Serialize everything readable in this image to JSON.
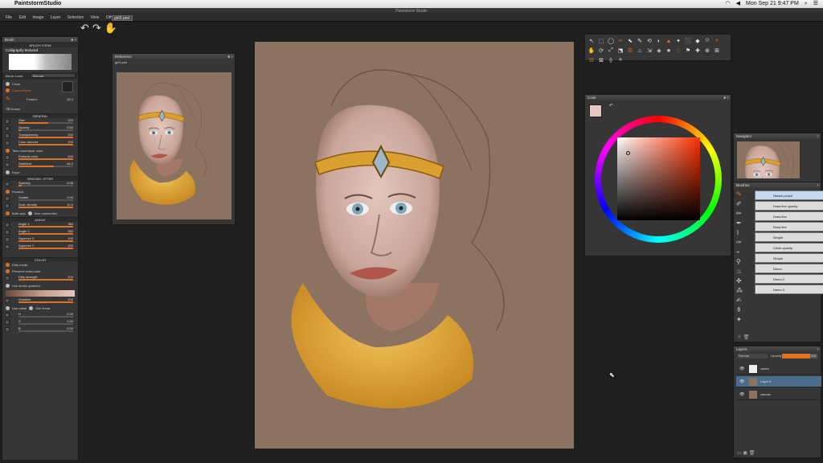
{
  "mac": {
    "app": "PaintstormStudio",
    "clock": "Mon Sep 21  9:47 PM"
  },
  "window": {
    "title": "Paintstorm Studio"
  },
  "menu": [
    "File",
    "Edit",
    "Image",
    "Layer",
    "Selection",
    "View",
    "Other"
  ],
  "doc_tab": "girl3.psd",
  "brush_panel": {
    "title": "Brush",
    "form_header": "BRUSH FORM",
    "form_name": "Calligraphy textured",
    "blend_mode_label": "Blend mode:",
    "blend_mode": "Normal",
    "shape_circle": "Circle",
    "shape_custom": "Custom form",
    "feature_label": "Feature",
    "feature_value": "26.3",
    "eraser": "Eraser",
    "general_header": "GENERAL",
    "general": [
      {
        "label": "Size",
        "value": "220",
        "pct": 55
      },
      {
        "label": "Opacity",
        "value": "0.50",
        "pct": 5
      },
      {
        "label": "Transparency",
        "value": "100",
        "pct": 100
      },
      {
        "label": "Color amount",
        "value": "100",
        "pct": 100
      }
    ],
    "take_under": "Take underlayer color",
    "general2": [
      {
        "label": "Extends color",
        "value": "100",
        "pct": 100
      },
      {
        "label": "Stabilizer",
        "value": "64.2",
        "pct": 64
      }
    ],
    "rope": "Rope",
    "spacing_header": "SPACING JITTER",
    "spacing": {
      "label": "Spacing",
      "value": "0.06",
      "pct": 6
    },
    "fixation": "Fixation",
    "scatter": {
      "label": "Scatter",
      "value": "0.00",
      "pct": 0
    },
    "scat_density": {
      "label": "Scat. density",
      "value": "10.0",
      "pct": 100
    },
    "both_axis": "Both axis",
    "size_connection": "Size connection",
    "angle_header": "ANGLE",
    "angles": [
      {
        "label": "Angle 1",
        "value": "360",
        "pct": 100
      },
      {
        "label": "Angle 2",
        "value": "360",
        "pct": 100
      },
      {
        "label": "Squeeze X",
        "value": "100",
        "pct": 100
      },
      {
        "label": "Squeeze Y",
        "value": "100",
        "pct": 100
      }
    ],
    "color_header": "COLOR",
    "dirty_mode": "Dirty mode",
    "preserve_main": "Preserve main color",
    "dirty_strength": {
      "label": "Dirty strength",
      "value": "100",
      "pct": 100
    },
    "use_stroke_gradient": "Use stroke gradient",
    "gradient": {
      "label": "Gradient",
      "value": "100",
      "pct": 100
    },
    "use_radial": "Use radial",
    "use_linear": "Use linear",
    "hsb": [
      {
        "label": "H",
        "value": "0.00",
        "pct": 0
      },
      {
        "label": "S",
        "value": "0.00",
        "pct": 0
      },
      {
        "label": "B",
        "value": "0.00",
        "pct": 0
      }
    ]
  },
  "reference_panel": {
    "title": "Reference",
    "file": "girl3.psd"
  },
  "color_panel": {
    "title": "Color"
  },
  "navigator_panel": {
    "title": "Navigator"
  },
  "brushes_panel": {
    "title": "Brushes",
    "items": [
      "Sketch pencil",
      "Draw line opacity",
      "Draw line",
      "Draw line",
      "Simple",
      "Circle opacity",
      "Simple",
      "Demo",
      "Demo 2",
      "Demo 3"
    ]
  },
  "layers_panel": {
    "title": "Layers",
    "blend": "Normal",
    "opacity_label": "Opacity",
    "opacity_value": "100",
    "layers": [
      {
        "name": "colors",
        "selected": false
      },
      {
        "name": "Layer 6",
        "selected": true
      },
      {
        "name": "canvas",
        "selected": false
      }
    ]
  },
  "colors": {
    "accent": "#e07020",
    "canvas_bg": "#8c7261",
    "selected_color": "#e6c8c0"
  }
}
